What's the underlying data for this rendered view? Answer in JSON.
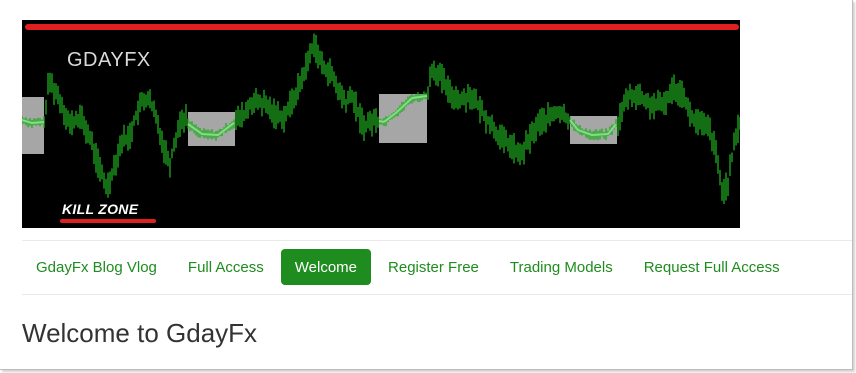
{
  "banner": {
    "logo_text": "GDAYFX",
    "kill_zone_label": "KILL ZONE",
    "colors": {
      "background": "#000000",
      "candles": "#1faa1f",
      "highlight_line": "#7ee07e",
      "zone_box": "#a6a6a6",
      "red_bar": "#e02020"
    }
  },
  "nav": {
    "items": [
      {
        "label": "GdayFx Blog Vlog",
        "active": false
      },
      {
        "label": "Full Access",
        "active": false
      },
      {
        "label": "Welcome",
        "active": true
      },
      {
        "label": "Register Free",
        "active": false
      },
      {
        "label": "Trading Models",
        "active": false
      },
      {
        "label": "Request Full Access",
        "active": false
      }
    ],
    "accent_color": "#1e8c1e"
  },
  "main": {
    "title": "Welcome to GdayFx"
  }
}
